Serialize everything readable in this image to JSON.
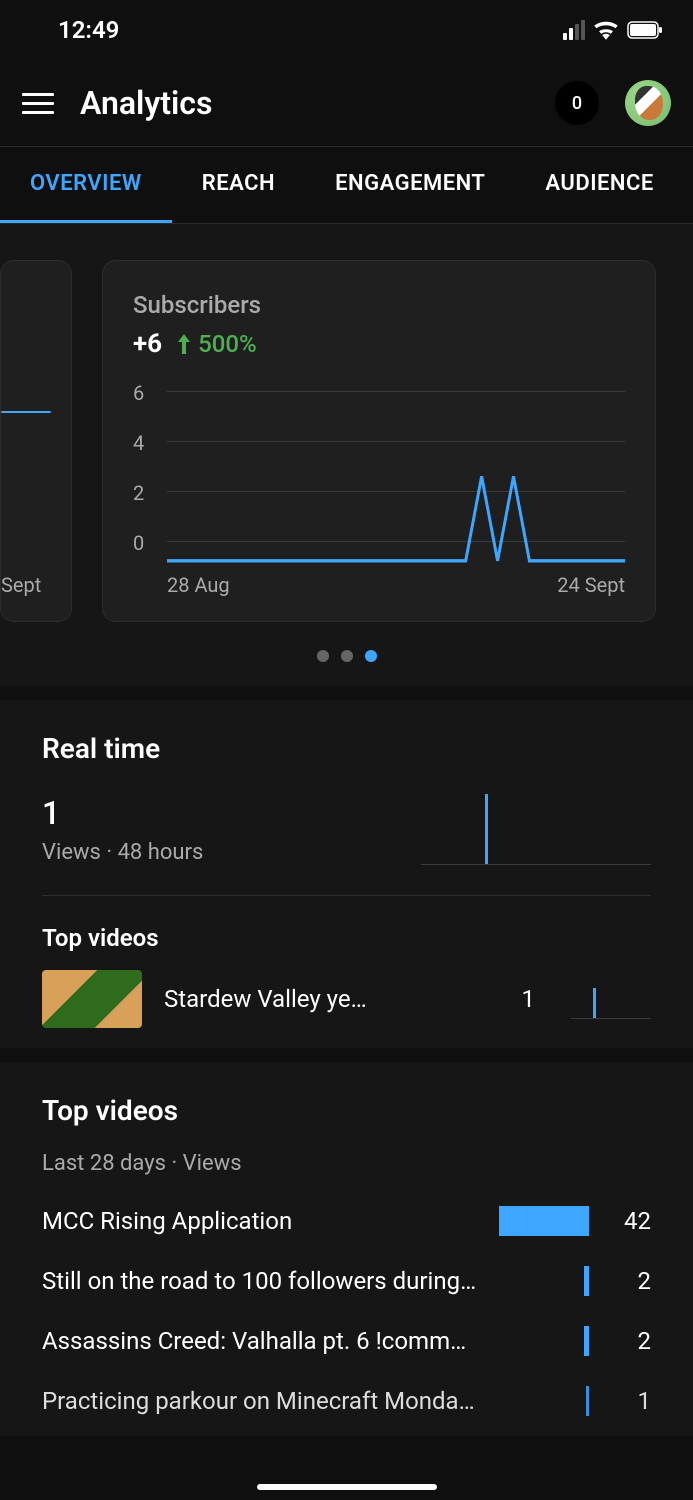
{
  "status": {
    "time": "12:49"
  },
  "header": {
    "title": "Analytics",
    "badge": "0"
  },
  "tabs": [
    "OVERVIEW",
    "REACH",
    "ENGAGEMENT",
    "AUDIENCE"
  ],
  "active_tab": 0,
  "card": {
    "title": "Subscribers",
    "value": "+6",
    "delta": "500%",
    "x_start": "28 Aug",
    "x_end": "24 Sept",
    "y_ticks": [
      "6",
      "4",
      "2",
      "0"
    ]
  },
  "peek_card": {
    "x_end": "Sept"
  },
  "carousel": {
    "count": 3,
    "active": 2
  },
  "realtime": {
    "heading": "Real time",
    "value": "1",
    "sub": "Views · 48 hours",
    "top_heading": "Top videos",
    "video": {
      "title": "Stardew Valley ye…",
      "views": "1"
    }
  },
  "top28": {
    "heading": "Top videos",
    "sub": "Last 28 days · Views",
    "rows": [
      {
        "title": "MCC Rising Application",
        "views": "42",
        "bar_pct": 100
      },
      {
        "title": "Still on the road to 100 followers during…",
        "views": "2",
        "bar_pct": 5
      },
      {
        "title": "Assassins Creed: Valhalla pt. 6 !comm…",
        "views": "2",
        "bar_pct": 5
      },
      {
        "title": "Practicing parkour on Minecraft Monda…",
        "views": "1",
        "bar_pct": 3
      }
    ]
  },
  "chart_data": {
    "type": "line",
    "title": "Subscribers",
    "xlabel": "",
    "ylabel": "",
    "ylim": [
      0,
      6
    ],
    "x_range": [
      "28 Aug",
      "24 Sept"
    ],
    "x": [
      0,
      1,
      2,
      3,
      4,
      5,
      6,
      7,
      8,
      9,
      10,
      11,
      12,
      13,
      14,
      15,
      16,
      17,
      18,
      19,
      20,
      21,
      22,
      23,
      24,
      25,
      26,
      27
    ],
    "values": [
      0,
      0,
      0,
      0,
      0,
      0,
      0,
      0,
      0,
      0,
      0,
      0,
      0,
      0,
      0,
      0,
      0,
      0,
      0,
      3,
      0,
      3,
      0,
      0,
      0,
      0,
      0,
      0
    ]
  }
}
